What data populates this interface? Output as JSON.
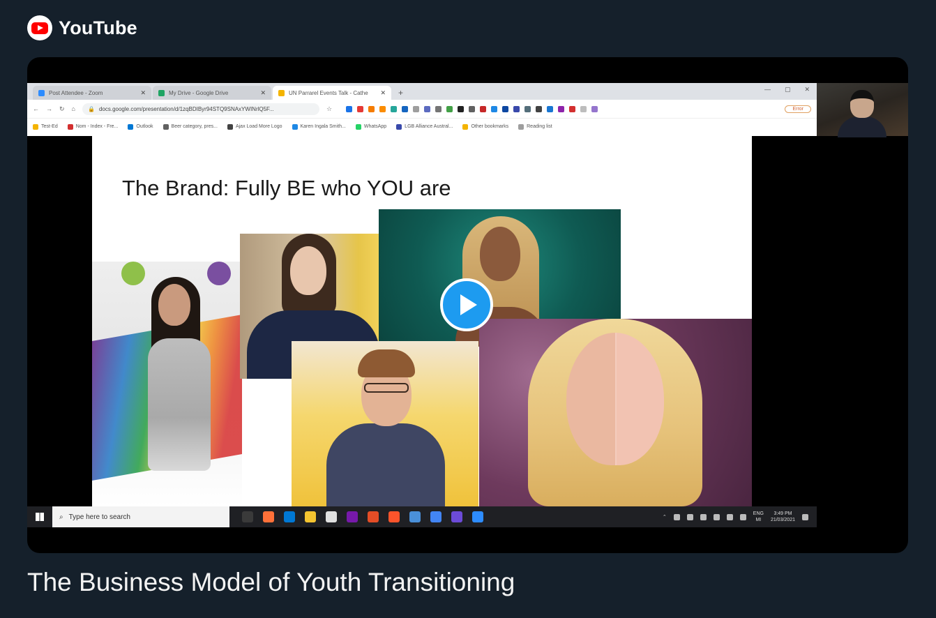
{
  "brand": {
    "name": "YouTube",
    "icon": "youtube-logo-icon"
  },
  "video": {
    "title": "The Business Model of Youth Transitioning",
    "browser": {
      "tabs": [
        {
          "label": "Post Attendee - Zoom",
          "color": "#2d8cff"
        },
        {
          "label": "My Drive - Google Drive",
          "color": "#1fa463"
        },
        {
          "label": "UN Parrarel Events Talk - Cathe",
          "color": "#f4b400"
        }
      ],
      "url": "docs.google.com/presentation/d/1zqBDIByr94STQ9SNAxYWINrlQ5F...",
      "error_label": "Error",
      "bookmarks": [
        "Test-Ed",
        "Nom - Index - Fre...",
        "Outlook",
        "Beer category, pres...",
        "Ajax Load More Logo",
        "Karen Ingala Smith...",
        "WhatsApp",
        "LGB Alliance Austral...",
        "Other bookmarks",
        "Reading list"
      ]
    },
    "slide": {
      "title": "The Brand: Fully BE who YOU are"
    },
    "taskbar": {
      "search_placeholder": "Type here to search",
      "lang_top": "ENG",
      "lang_bottom": "MI",
      "time": "3:49 PM",
      "date": "21/03/2021"
    }
  }
}
